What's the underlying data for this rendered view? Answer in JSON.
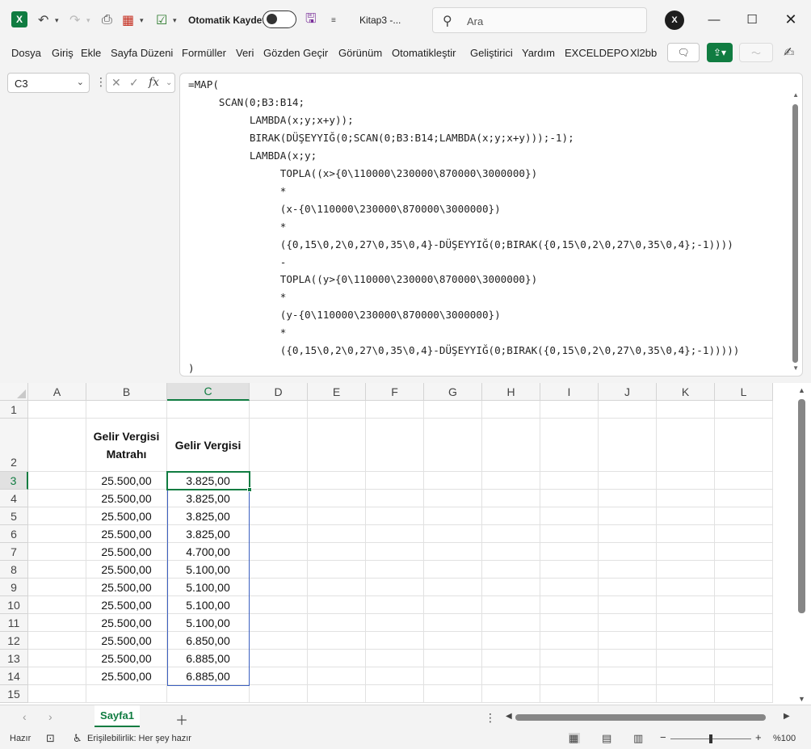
{
  "titlebar": {
    "autosave_label": "Otomatik Kaydet",
    "filename": "Kitap3  -...",
    "search_placeholder": "Ara",
    "avatar_text": "X"
  },
  "menu": [
    "Dosya",
    "Giriş",
    "Ekle",
    "Sayfa Düzeni",
    "Formüller",
    "Veri",
    "Gözden Geçir",
    "Görünüm",
    "Otomatikleştir",
    "Geliştirici",
    "Yardım",
    "EXCELDEPO",
    "Xl2bb"
  ],
  "formula_bar": {
    "name_box": "C3",
    "fx_label": "fx",
    "formula_lines": [
      "=MAP(",
      "     SCAN(0;B3:B14;",
      "          LAMBDA(x;y;x+y));",
      "          BIRAK(DÜŞEYYIĞ(0;SCAN(0;B3:B14;LAMBDA(x;y;x+y)));-1);",
      "          LAMBDA(x;y;",
      "               TOPLA((x>{0\\110000\\230000\\870000\\3000000})",
      "               *",
      "               (x-{0\\110000\\230000\\870000\\3000000})",
      "               *",
      "               ({0,15\\0,2\\0,27\\0,35\\0,4}-DÜŞEYYIĞ(0;BIRAK({0,15\\0,2\\0,27\\0,35\\0,4};-1))))",
      "               -",
      "               TOPLA((y>{0\\110000\\230000\\870000\\3000000})",
      "               *",
      "               (y-{0\\110000\\230000\\870000\\3000000})",
      "               *",
      "               ({0,15\\0,2\\0,27\\0,35\\0,4}-DÜŞEYYIĞ(0;BIRAK({0,15\\0,2\\0,27\\0,35\\0,4};-1)))))",
      ")"
    ]
  },
  "sheet": {
    "columns": [
      "A",
      "B",
      "C",
      "D",
      "E",
      "F",
      "G",
      "H",
      "I",
      "J",
      "K",
      "L"
    ],
    "rows": [
      "1",
      "2",
      "3",
      "4",
      "5",
      "6",
      "7",
      "8",
      "9",
      "10",
      "11",
      "12",
      "13",
      "14",
      "15"
    ],
    "header_b": "Gelir Vergisi Matrahı",
    "header_c": "Gelir Vergisi",
    "data": [
      [
        "25.500,00",
        "3.825,00"
      ],
      [
        "25.500,00",
        "3.825,00"
      ],
      [
        "25.500,00",
        "3.825,00"
      ],
      [
        "25.500,00",
        "3.825,00"
      ],
      [
        "25.500,00",
        "4.700,00"
      ],
      [
        "25.500,00",
        "5.100,00"
      ],
      [
        "25.500,00",
        "5.100,00"
      ],
      [
        "25.500,00",
        "5.100,00"
      ],
      [
        "25.500,00",
        "5.100,00"
      ],
      [
        "25.500,00",
        "6.850,00"
      ],
      [
        "25.500,00",
        "6.885,00"
      ],
      [
        "25.500,00",
        "6.885,00"
      ]
    ],
    "active_cell": "C3",
    "tab": "Sayfa1"
  },
  "status": {
    "ready": "Hazır",
    "accessibility": "Erişilebilirlik: Her şey hazır",
    "zoom": "%100"
  },
  "colors": {
    "excel_green": "#107c41",
    "selection_blue": "#3b5fc0"
  }
}
